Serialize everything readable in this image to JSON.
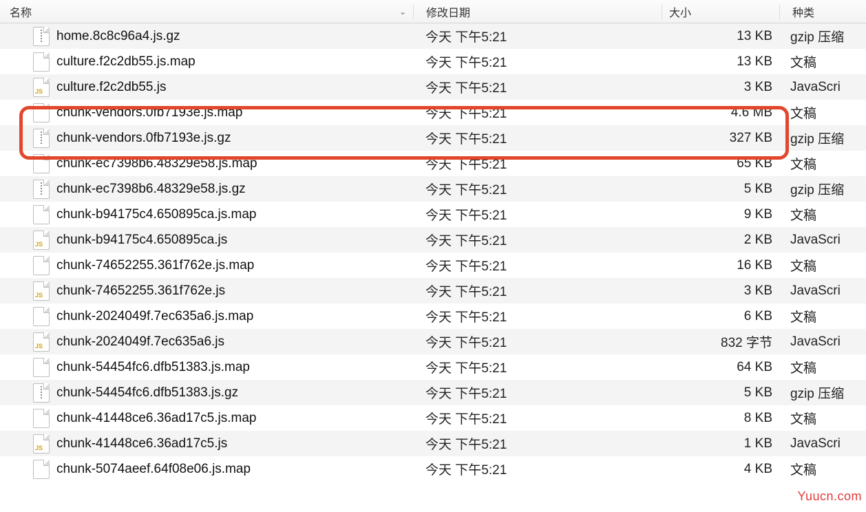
{
  "header": {
    "name": "名称",
    "date": "修改日期",
    "size": "大小",
    "kind": "种类"
  },
  "watermark": "Yuucn.com",
  "files": [
    {
      "name": "home.8c8c96a4.js.gz",
      "date": "今天 下午5:21",
      "size": "13 KB",
      "kind": "gzip 压缩",
      "icon": "gz"
    },
    {
      "name": "culture.f2c2db55.js.map",
      "date": "今天 下午5:21",
      "size": "13 KB",
      "kind": "文稿",
      "icon": "doc"
    },
    {
      "name": "culture.f2c2db55.js",
      "date": "今天 下午5:21",
      "size": "3 KB",
      "kind": "JavaScri",
      "icon": "js"
    },
    {
      "name": "chunk-vendors.0fb7193e.js.map",
      "date": "今天 下午5:21",
      "size": "4.6 MB",
      "kind": "文稿",
      "icon": "doc"
    },
    {
      "name": "chunk-vendors.0fb7193e.js.gz",
      "date": "今天 下午5:21",
      "size": "327 KB",
      "kind": "gzip 压缩",
      "icon": "gz"
    },
    {
      "name": "chunk-ec7398b6.48329e58.js.map",
      "date": "今天 下午5:21",
      "size": "65 KB",
      "kind": "文稿",
      "icon": "doc"
    },
    {
      "name": "chunk-ec7398b6.48329e58.js.gz",
      "date": "今天 下午5:21",
      "size": "5 KB",
      "kind": "gzip 压缩",
      "icon": "gz"
    },
    {
      "name": "chunk-b94175c4.650895ca.js.map",
      "date": "今天 下午5:21",
      "size": "9 KB",
      "kind": "文稿",
      "icon": "doc"
    },
    {
      "name": "chunk-b94175c4.650895ca.js",
      "date": "今天 下午5:21",
      "size": "2 KB",
      "kind": "JavaScri",
      "icon": "js"
    },
    {
      "name": "chunk-74652255.361f762e.js.map",
      "date": "今天 下午5:21",
      "size": "16 KB",
      "kind": "文稿",
      "icon": "doc"
    },
    {
      "name": "chunk-74652255.361f762e.js",
      "date": "今天 下午5:21",
      "size": "3 KB",
      "kind": "JavaScri",
      "icon": "js"
    },
    {
      "name": "chunk-2024049f.7ec635a6.js.map",
      "date": "今天 下午5:21",
      "size": "6 KB",
      "kind": "文稿",
      "icon": "doc"
    },
    {
      "name": "chunk-2024049f.7ec635a6.js",
      "date": "今天 下午5:21",
      "size": "832 字节",
      "kind": "JavaScri",
      "icon": "js"
    },
    {
      "name": "chunk-54454fc6.dfb51383.js.map",
      "date": "今天 下午5:21",
      "size": "64 KB",
      "kind": "文稿",
      "icon": "doc"
    },
    {
      "name": "chunk-54454fc6.dfb51383.js.gz",
      "date": "今天 下午5:21",
      "size": "5 KB",
      "kind": "gzip 压缩",
      "icon": "gz"
    },
    {
      "name": "chunk-41448ce6.36ad17c5.js.map",
      "date": "今天 下午5:21",
      "size": "8 KB",
      "kind": "文稿",
      "icon": "doc"
    },
    {
      "name": "chunk-41448ce6.36ad17c5.js",
      "date": "今天 下午5:21",
      "size": "1 KB",
      "kind": "JavaScri",
      "icon": "js"
    },
    {
      "name": "chunk-5074aeef.64f08e06.js.map",
      "date": "今天 下午5:21",
      "size": "4 KB",
      "kind": "文稿",
      "icon": "doc"
    }
  ]
}
